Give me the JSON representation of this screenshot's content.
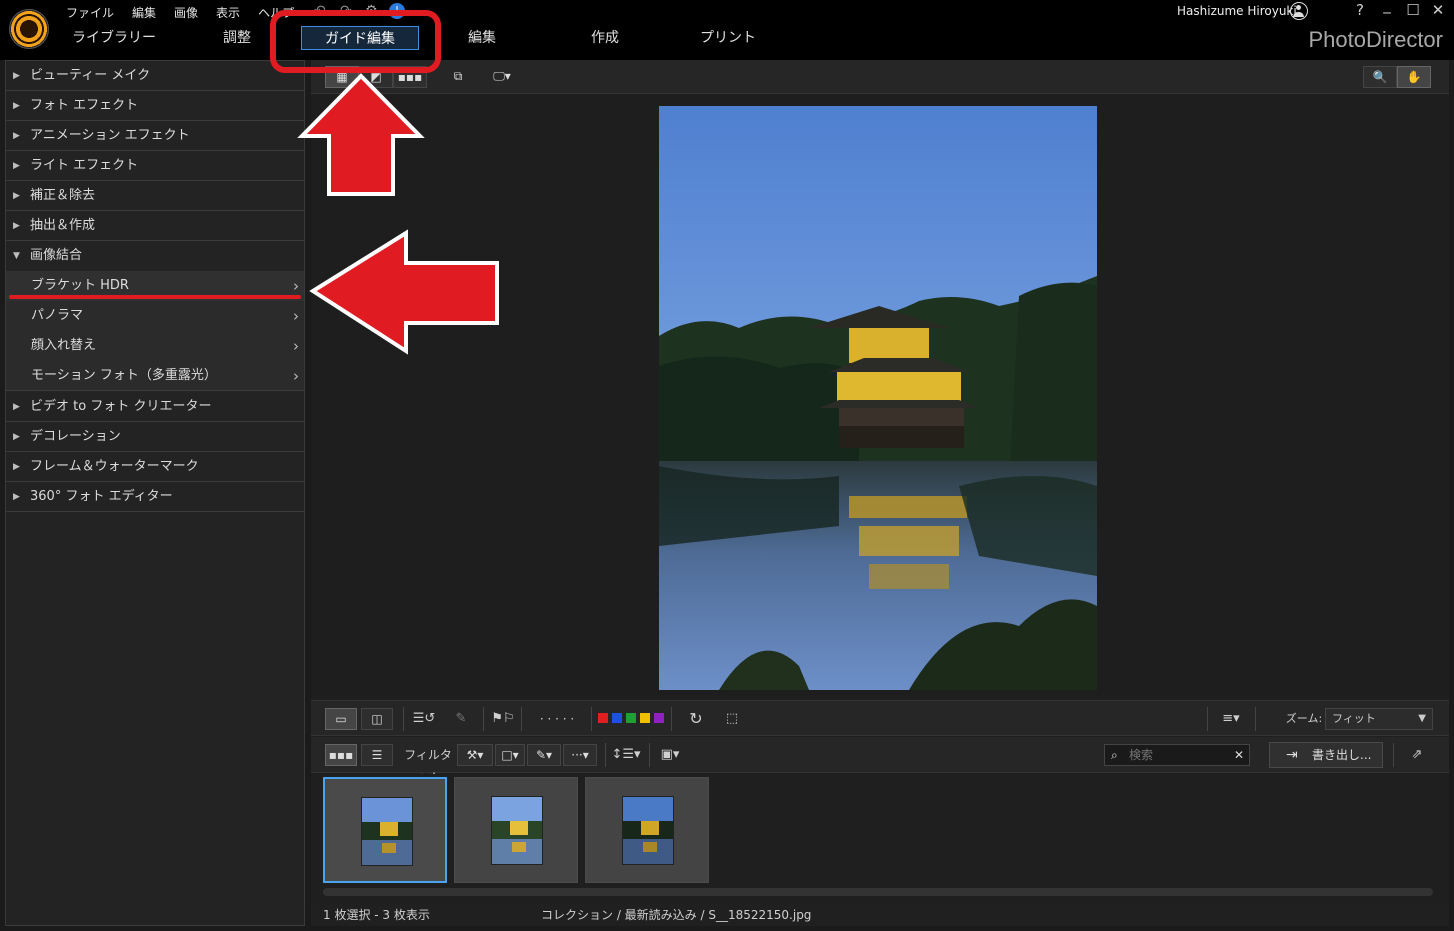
{
  "menu": [
    "ファイル",
    "編集",
    "画像",
    "表示",
    "ヘルプ"
  ],
  "user": {
    "name": "Hashizume Hiroyuki"
  },
  "window": {
    "help": "?",
    "minimize": "_",
    "maximize": "☐",
    "close": "✕"
  },
  "tabs": [
    "ライブラリー",
    "調整",
    "ガイド編集",
    "編集",
    "作成",
    "プリント"
  ],
  "active_tab": "ガイド編集",
  "brand": "PhotoDirector",
  "left_panel": {
    "sections": [
      {
        "label": "ビューティー メイク",
        "expanded": false
      },
      {
        "label": "フォト エフェクト",
        "expanded": false
      },
      {
        "label": "アニメーション エフェクト",
        "expanded": false
      },
      {
        "label": "ライト エフェクト",
        "expanded": false
      },
      {
        "label": "補正＆除去",
        "expanded": false
      },
      {
        "label": "抽出＆作成",
        "expanded": false
      },
      {
        "label": "画像結合",
        "expanded": true
      },
      {
        "label": "ビデオ to フォト クリエーター",
        "expanded": false
      },
      {
        "label": "デコレーション",
        "expanded": false
      },
      {
        "label": "フレーム＆ウォーターマーク",
        "expanded": false
      },
      {
        "label": "360° フォト エディター",
        "expanded": false
      }
    ],
    "subitems": [
      "ブラケット HDR",
      "パノラマ",
      "顔入れ替え",
      "モーション フォト（多重露光）"
    ],
    "selected_subitem": "ブラケット HDR"
  },
  "toolbar_bottom": {
    "zoom_label": "ズーム:",
    "zoom_value": "フィット",
    "filter_label": "フィルター:",
    "search_placeholder": "検索",
    "export_label": "書き出し...",
    "color_labels": [
      "#e02020",
      "#2050e0",
      "#20a030",
      "#f0c000",
      "#9020c0"
    ],
    "rating_dots": "· · · · ·"
  },
  "filmstrip": {
    "count": 3,
    "selected_index": 0
  },
  "status": {
    "selection": "1 枚選択 - 3 枚表示",
    "path": "コレクション / 最新読み込み / S__18522150.jpg"
  },
  "annotation_colors": {
    "highlight": "#e11b22"
  }
}
